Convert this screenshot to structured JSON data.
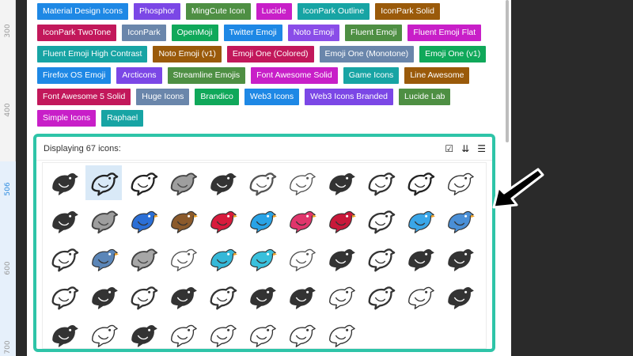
{
  "ruler": {
    "marks": [
      {
        "label": "300",
        "hl": false
      },
      {
        "label": "400",
        "hl": false
      },
      {
        "label": "506",
        "hl": true
      },
      {
        "label": "600",
        "hl": false
      },
      {
        "label": "700",
        "hl": false
      },
      {
        "label": "800",
        "hl": false
      }
    ]
  },
  "tags": [
    [
      {
        "label": "Material Design Icons",
        "color": "#1e88e5"
      },
      {
        "label": "Phosphor",
        "color": "#7b47e6"
      },
      {
        "label": "MingCute Icon",
        "color": "#4e8f43"
      },
      {
        "label": "Lucide",
        "color": "#c81fc8"
      },
      {
        "label": "IconPark Outline",
        "color": "#17a4a4"
      },
      {
        "label": "IconPark Solid",
        "color": "#9a5a0a"
      }
    ],
    [
      {
        "label": "IconPark TwoTone",
        "color": "#c2185b"
      },
      {
        "label": "IconPark",
        "color": "#6a86ab"
      },
      {
        "label": "OpenMoji",
        "color": "#10a85a"
      },
      {
        "label": "Twitter Emoji",
        "color": "#1e88e5"
      },
      {
        "label": "Noto Emoji",
        "color": "#8a4de8"
      },
      {
        "label": "Fluent Emoji",
        "color": "#4e8f43"
      },
      {
        "label": "Fluent Emoji Flat",
        "color": "#c81fc8"
      }
    ],
    [
      {
        "label": "Fluent Emoji High Contrast",
        "color": "#17a4a4"
      },
      {
        "label": "Noto Emoji (v1)",
        "color": "#9a5a0a"
      },
      {
        "label": "Emoji One (Colored)",
        "color": "#c2185b"
      },
      {
        "label": "Emoji One (Monotone)",
        "color": "#6a86ab"
      },
      {
        "label": "Emoji One (v1)",
        "color": "#10a85a"
      }
    ],
    [
      {
        "label": "Firefox OS Emoji",
        "color": "#1e88e5"
      },
      {
        "label": "Arcticons",
        "color": "#7b47e6"
      },
      {
        "label": "Streamline Emojis",
        "color": "#4e8f43"
      },
      {
        "label": "Font Awesome Solid",
        "color": "#c81fc8"
      },
      {
        "label": "Game Icons",
        "color": "#17a4a4"
      },
      {
        "label": "Line Awesome",
        "color": "#9a5a0a"
      }
    ],
    [
      {
        "label": "Font Awesome 5 Solid",
        "color": "#c2185b"
      },
      {
        "label": "Huge Icons",
        "color": "#6a86ab"
      },
      {
        "label": "Brandico",
        "color": "#10a85a"
      },
      {
        "label": "Web3 Icons",
        "color": "#1e88e5"
      },
      {
        "label": "Web3 Icons Branded",
        "color": "#7b47e6"
      },
      {
        "label": "Lucide Lab",
        "color": "#4e8f43"
      }
    ],
    [
      {
        "label": "Simple Icons",
        "color": "#c81fc8"
      },
      {
        "label": "Raphael",
        "color": "#17a4a4"
      }
    ]
  ],
  "results": {
    "title": "Displaying 67 icons:",
    "tools": [
      {
        "name": "select-all-icon",
        "glyph": "☑"
      },
      {
        "name": "collapse-icon",
        "glyph": "⇊"
      },
      {
        "name": "menu-icon",
        "glyph": "☰"
      }
    ]
  },
  "icons": [
    {
      "name": "bird-icon",
      "style": "solid",
      "color": "#333333"
    },
    {
      "name": "bird-outline-icon",
      "style": "outline",
      "color": "#222222",
      "selected": true
    },
    {
      "name": "bird-outline-icon",
      "style": "outline",
      "color": "#222222"
    },
    {
      "name": "bird-twotone-icon",
      "style": "twotone",
      "color": "#9e9e9e"
    },
    {
      "name": "bird-solid-icon",
      "style": "solid",
      "color": "#333333"
    },
    {
      "name": "bird-outline-icon",
      "style": "outline",
      "color": "#555555"
    },
    {
      "name": "bird-thin-icon",
      "style": "thin",
      "color": "#555555"
    },
    {
      "name": "bird-solid-icon",
      "style": "solid",
      "color": "#333333"
    },
    {
      "name": "bird-outline-icon",
      "style": "outline",
      "color": "#333333"
    },
    {
      "name": "bird-line-icon",
      "style": "outline",
      "color": "#222222"
    },
    {
      "name": "bird-outline-icon",
      "style": "thin",
      "color": "#333333"
    },
    {
      "name": "bird-solid-icon",
      "style": "solid",
      "color": "#333333"
    },
    {
      "name": "bird-gray-icon",
      "style": "twotone",
      "color": "#9e9e9e"
    },
    {
      "name": "bird-blue-icon",
      "style": "color",
      "color": "#2b6fd6"
    },
    {
      "name": "sparrow-icon",
      "style": "color",
      "color": "#8b5a2b"
    },
    {
      "name": "cardinal-icon",
      "style": "color",
      "color": "#d81b3c"
    },
    {
      "name": "blue-bird-icon",
      "style": "color",
      "color": "#29a3e6"
    },
    {
      "name": "pink-bird-icon",
      "style": "color",
      "color": "#e0356b"
    },
    {
      "name": "red-bird-icon",
      "style": "color",
      "color": "#c9183a"
    },
    {
      "name": "bird-outline-icon",
      "style": "outline",
      "color": "#333333"
    },
    {
      "name": "twitter-bird-icon",
      "style": "color",
      "color": "#3aa6e8"
    },
    {
      "name": "blue-bird-icon",
      "style": "color",
      "color": "#4a8fd6"
    },
    {
      "name": "bird-outline-icon",
      "style": "outline",
      "color": "#333333"
    },
    {
      "name": "owl-icon",
      "style": "color",
      "color": "#5b86b8"
    },
    {
      "name": "bird-gray-icon",
      "style": "twotone",
      "color": "#a7a7a7"
    },
    {
      "name": "bird-wing-icon",
      "style": "thin",
      "color": "#555555"
    },
    {
      "name": "teal-bird-icon",
      "style": "color",
      "color": "#35b8d8"
    },
    {
      "name": "teal-bird-icon",
      "style": "color",
      "color": "#39c0dc"
    },
    {
      "name": "bird-outline-icon",
      "style": "thin",
      "color": "#555555"
    },
    {
      "name": "kiwi-icon",
      "style": "solid",
      "color": "#333333"
    },
    {
      "name": "birdcage-icon",
      "style": "outline",
      "color": "#333333"
    },
    {
      "name": "bird-claw-icon",
      "style": "solid",
      "color": "#333333"
    },
    {
      "name": "bird-claw-icon",
      "style": "solid",
      "color": "#333333"
    },
    {
      "name": "bird-head-icon",
      "style": "outline",
      "color": "#333333"
    },
    {
      "name": "kiwi-icon",
      "style": "solid",
      "color": "#333333"
    },
    {
      "name": "kiwi-outline-icon",
      "style": "outline",
      "color": "#333333"
    },
    {
      "name": "kiwi-icon",
      "style": "solid",
      "color": "#333333"
    },
    {
      "name": "bird-outline-icon",
      "style": "outline",
      "color": "#333333"
    },
    {
      "name": "crow-icon",
      "style": "solid",
      "color": "#333333"
    },
    {
      "name": "crow-icon",
      "style": "solid",
      "color": "#333333"
    },
    {
      "name": "parrot-icon",
      "style": "thin",
      "color": "#333333"
    },
    {
      "name": "birdhouse-icon",
      "style": "outline",
      "color": "#333333"
    },
    {
      "name": "bird-outline-icon",
      "style": "thin",
      "color": "#333333"
    },
    {
      "name": "twitter-icon",
      "style": "solid",
      "color": "#333333"
    },
    {
      "name": "crow-icon",
      "style": "solid",
      "color": "#333333"
    },
    {
      "name": "bird-line-icon",
      "style": "thin",
      "color": "#333333"
    },
    {
      "name": "eagle-icon",
      "style": "solid",
      "color": "#333333"
    },
    {
      "name": "bird-outline-icon",
      "style": "thin",
      "color": "#333333"
    },
    {
      "name": "bird-branch-icon",
      "style": "thin",
      "color": "#333333"
    },
    {
      "name": "bird-circle-icon",
      "style": "thin",
      "color": "#333333"
    },
    {
      "name": "bird-branch-icon",
      "style": "thin",
      "color": "#333333"
    },
    {
      "name": "bird-circle-icon",
      "style": "thin",
      "color": "#333333"
    }
  ]
}
